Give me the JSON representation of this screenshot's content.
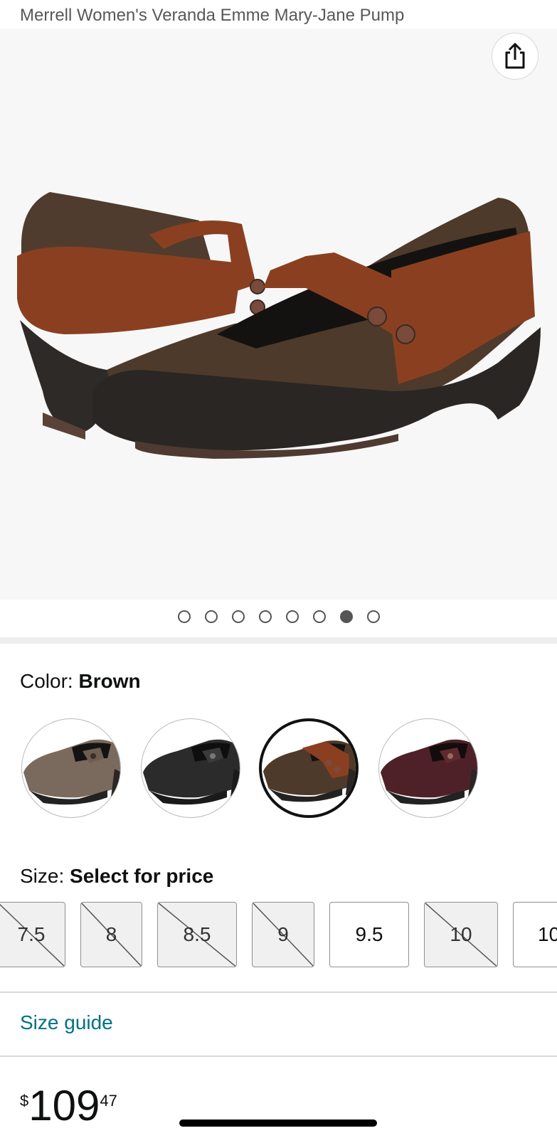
{
  "product": {
    "title": "Merrell Women's Veranda Emme Mary-Jane Pump"
  },
  "gallery": {
    "share_icon": "share-icon",
    "image_count": 8,
    "active_image_index": 6
  },
  "color": {
    "label": "Color:",
    "selected": "Brown",
    "swatches": [
      {
        "color_hex": "#7a6a5e",
        "selected": false
      },
      {
        "color_hex": "#2b2b2b",
        "selected": false
      },
      {
        "color_hex": "#5a4432",
        "selected": true
      },
      {
        "color_hex": "#4e2128",
        "selected": false
      }
    ]
  },
  "size": {
    "label": "Size:",
    "selected": "Select for price",
    "options": [
      {
        "label": "7.5",
        "available": false
      },
      {
        "label": "8",
        "available": false
      },
      {
        "label": "8.5",
        "available": false
      },
      {
        "label": "9",
        "available": false
      },
      {
        "label": "9.5",
        "available": true
      },
      {
        "label": "10",
        "available": false
      },
      {
        "label": "10",
        "available": true
      }
    ]
  },
  "size_guide": {
    "label": "Size guide"
  },
  "price": {
    "symbol": "$",
    "whole": "109",
    "fraction": "47"
  },
  "colors": {
    "link": "#007185",
    "text": "#0f1111",
    "title_gray": "#565959"
  }
}
